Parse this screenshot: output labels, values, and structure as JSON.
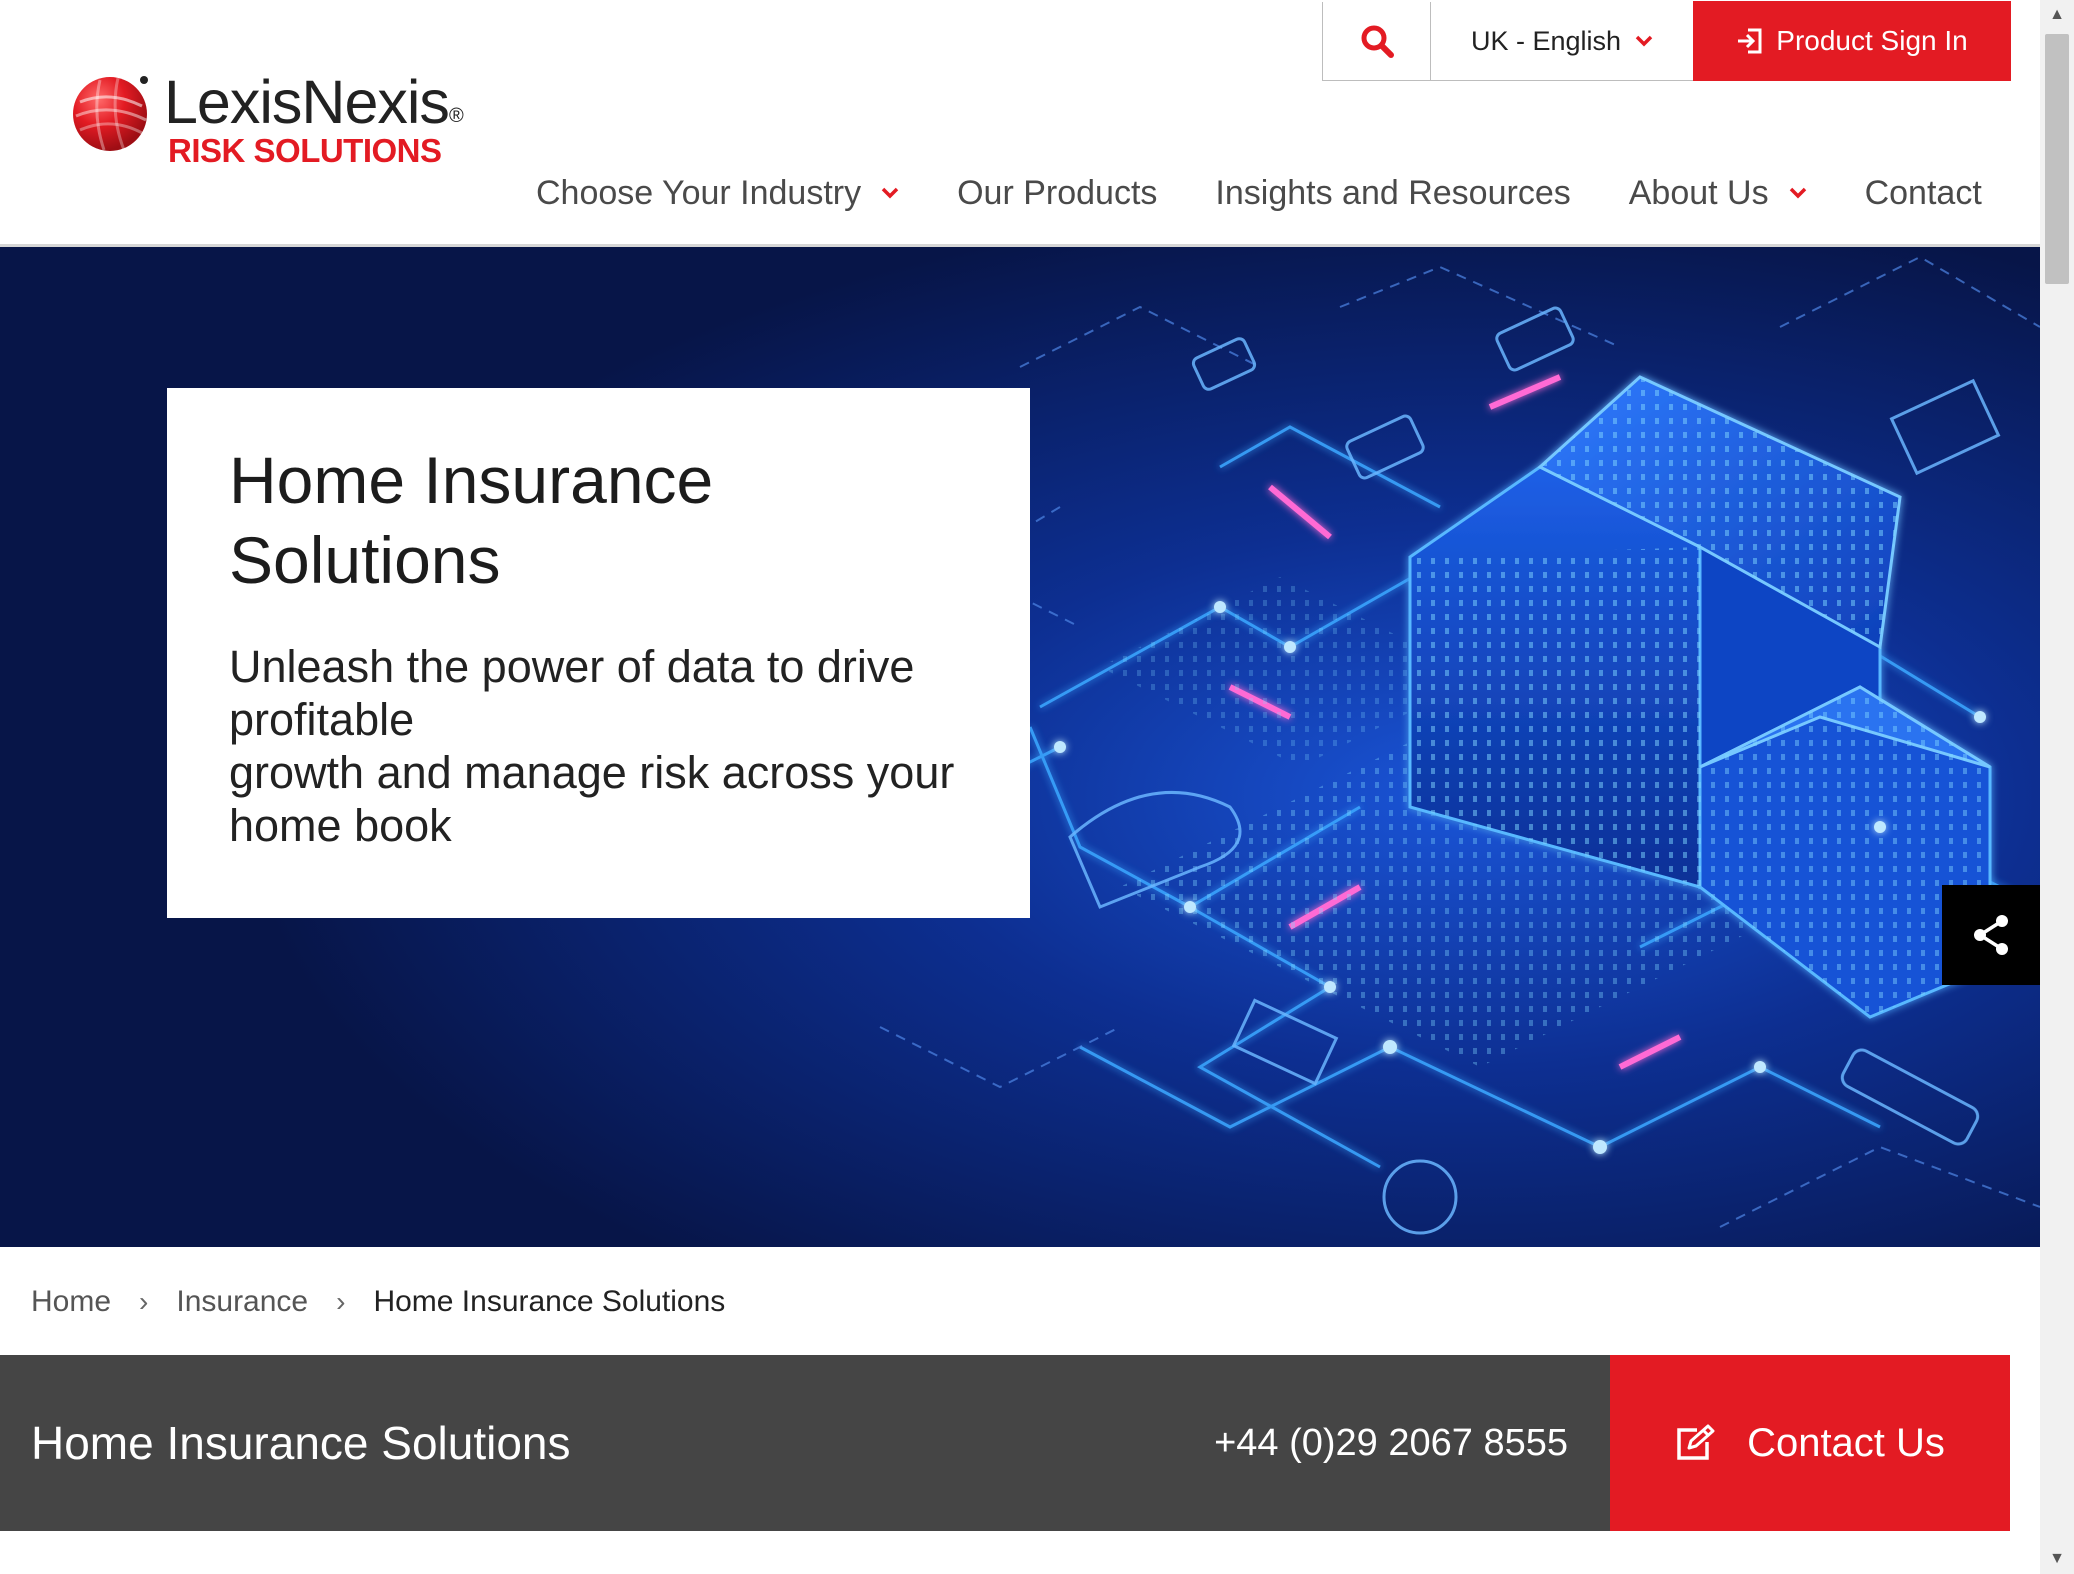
{
  "brand": {
    "name": "LexisNexis",
    "registered_mark": "®",
    "tagline": "RISK SOLUTIONS",
    "accent_color": "#e31b23"
  },
  "utility": {
    "search_icon": "search-icon",
    "language": "UK - English",
    "signin_label": "Product Sign In",
    "signin_icon": "sign-in-icon"
  },
  "nav": {
    "items": [
      {
        "label": "Choose Your Industry",
        "dropdown": true
      },
      {
        "label": "Our Products",
        "dropdown": false
      },
      {
        "label": "Insights and Resources",
        "dropdown": false
      },
      {
        "label": "About Us",
        "dropdown": true
      },
      {
        "label": "Contact",
        "dropdown": false
      }
    ]
  },
  "hero": {
    "title": "Home Insurance Solutions",
    "subtitle_line1": "Unleash the power of data to drive profitable",
    "subtitle_line2": "growth and manage risk across your home book",
    "share_icon": "share-icon"
  },
  "breadcrumb": {
    "items": [
      "Home",
      "Insurance",
      "Home Insurance Solutions"
    ],
    "separator": "›"
  },
  "contact_bar": {
    "title": "Home Insurance Solutions",
    "phone": "+44 (0)29 2067 8555",
    "button_label": "Contact Us",
    "button_icon": "edit-icon"
  },
  "scrollbar": {
    "up": "▲",
    "down": "▼"
  }
}
